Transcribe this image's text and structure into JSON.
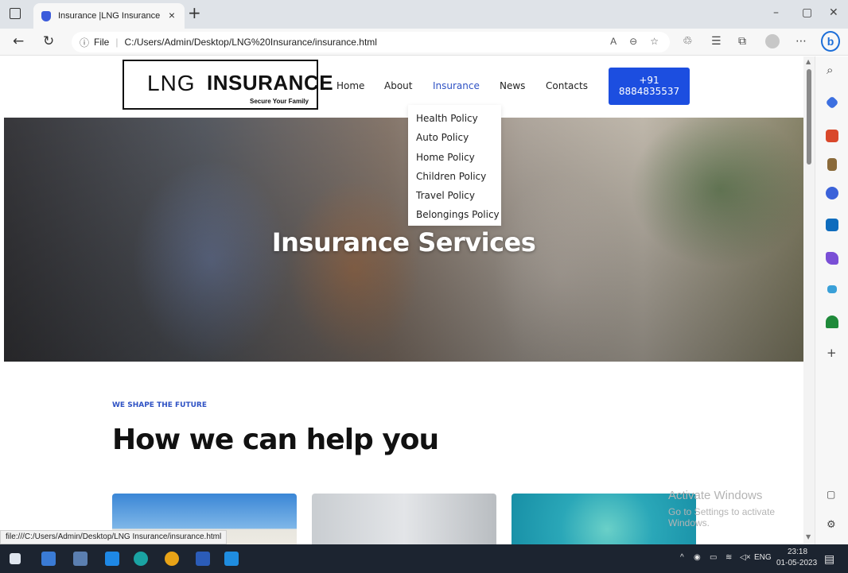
{
  "browser": {
    "tab_title": "Insurance |LNG Insurance",
    "tab_close": "×",
    "new_tab": "+",
    "url_scheme": "File",
    "url": "C:/Users/Admin/Desktop/LNG%20Insurance/insurance.html",
    "min": "–",
    "restore": "▢",
    "close": "✕",
    "bing": "b"
  },
  "site": {
    "logo_lng": "LNG",
    "logo_insurance": "INSURANCE",
    "logo_tagline": "Secure Your Family",
    "nav": {
      "home": "Home",
      "about": "About",
      "insurance": "Insurance",
      "news": "News",
      "contacts": "Contacts"
    },
    "phone_line1": "+91",
    "phone_line2": "8884835537",
    "dropdown": [
      "Health Policy",
      "Auto Policy",
      "Home Policy",
      "Children Policy",
      "Travel Policy",
      "Belongings Policy"
    ],
    "hero_title": "Insurance Services",
    "eyebrow": "WE SHAPE THE FUTURE",
    "section_title": "How we can help you"
  },
  "overlay": {
    "activate_line1": "Activate Windows",
    "activate_line2": "Go to Settings to activate Windows.",
    "status_link": "file:///C:/Users/Admin/Desktop/LNG Insurance/insurance.html"
  },
  "taskbar": {
    "lang": "ENG",
    "time": "23:18",
    "date": "01-05-2023"
  },
  "colors": {
    "accent": "#1c4ee0",
    "nav_active": "#2f52c4"
  }
}
